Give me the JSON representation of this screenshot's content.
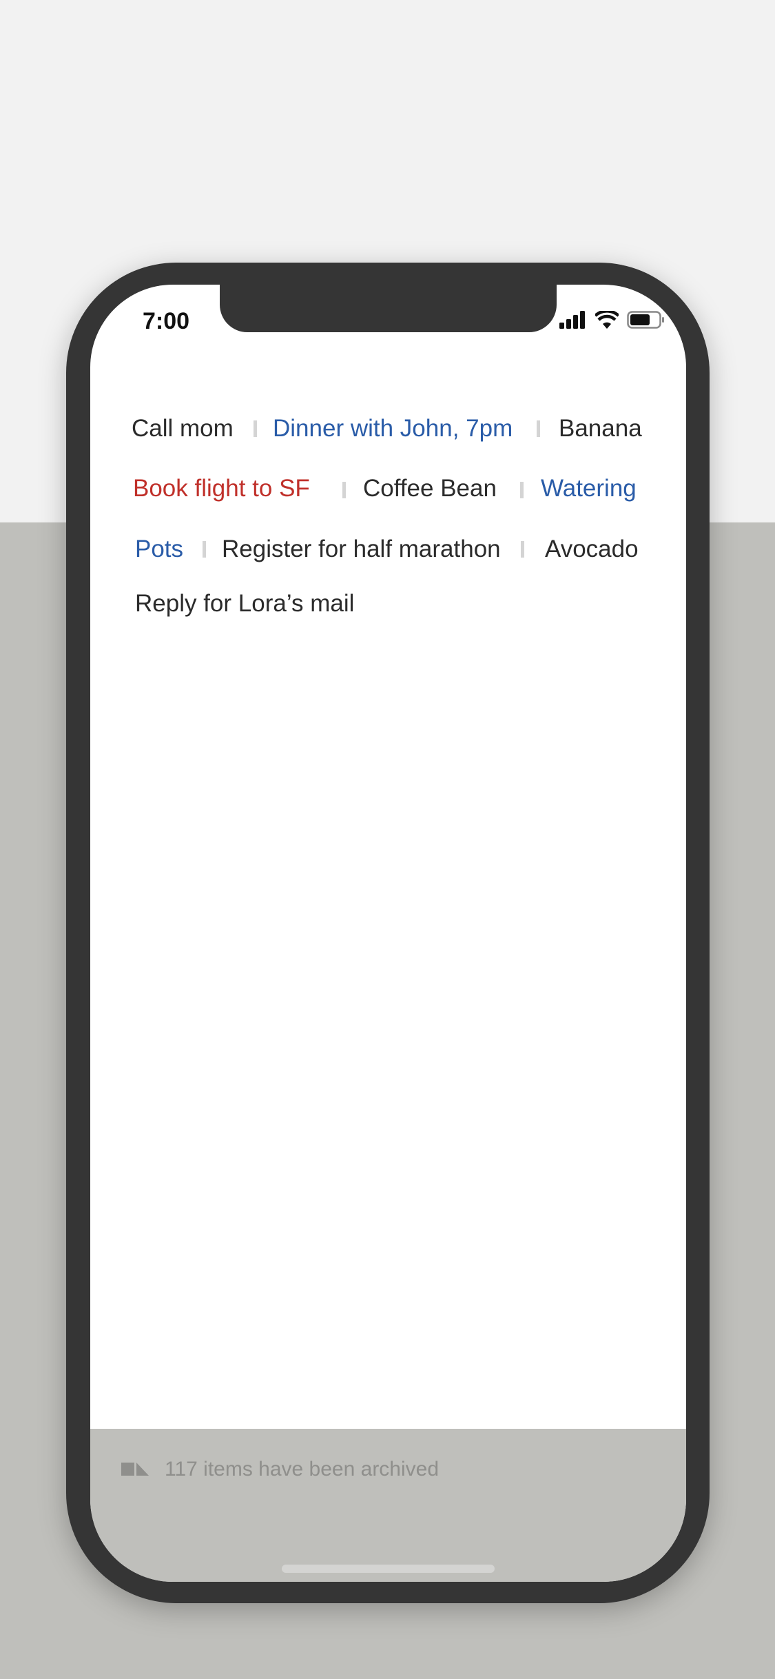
{
  "status_bar": {
    "time": "7:00",
    "icons": [
      "signal-icon",
      "wifi-icon",
      "battery-icon"
    ]
  },
  "items": [
    {
      "label": "Call mom",
      "color": "#2b2b2b"
    },
    {
      "label": "Dinner with John, 7pm",
      "color": "#2a5ca8"
    },
    {
      "label": "Banana",
      "color": "#2b2b2b"
    },
    {
      "label": "Book flight to SF",
      "color": "#c0302a"
    },
    {
      "label": "Coffee Bean",
      "color": "#2b2b2b"
    },
    {
      "label": "Watering",
      "color": "#2a5ca8"
    },
    {
      "label": "Pots",
      "color": "#2a5ca8"
    },
    {
      "label": "Register for half marathon",
      "color": "#2b2b2b"
    },
    {
      "label": "Avocado",
      "color": "#2b2b2b"
    },
    {
      "label": "Reply for Lora’s mail",
      "color": "#2b2b2b"
    }
  ],
  "footer": {
    "icon": "archive-icon",
    "message": "117 items have been archived"
  }
}
